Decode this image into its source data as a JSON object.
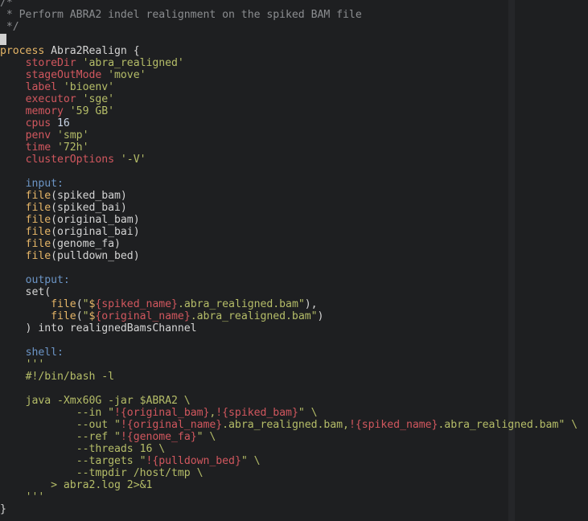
{
  "editor": {
    "theme_colors": {
      "background": "#1e1f21",
      "comment": "#8b8d90",
      "keyword": "#e5b567",
      "property": "#d1575e",
      "string": "#b5bd68",
      "number": "#c9d4e6",
      "label": "#6c95c6",
      "plain": "#d4d4d4"
    },
    "lines": [
      [
        {
          "t": "comment",
          "v": "/*"
        }
      ],
      [
        {
          "t": "comment",
          "v": " * Perform ABRA2 indel realignment on the spiked BAM file"
        }
      ],
      [
        {
          "t": "comment",
          "v": " */"
        }
      ],
      [
        {
          "t": "cursor",
          "v": ""
        }
      ],
      [
        {
          "t": "kw",
          "v": "process"
        },
        {
          "t": "plain",
          "v": " Abra2Realign {"
        }
      ],
      [
        {
          "t": "plain",
          "v": "    "
        },
        {
          "t": "prop",
          "v": "storeDir"
        },
        {
          "t": "plain",
          "v": " "
        },
        {
          "t": "str",
          "v": "'abra_realigned'"
        }
      ],
      [
        {
          "t": "plain",
          "v": "    "
        },
        {
          "t": "prop",
          "v": "stageOutMode"
        },
        {
          "t": "plain",
          "v": " "
        },
        {
          "t": "str",
          "v": "'move'"
        }
      ],
      [
        {
          "t": "plain",
          "v": "    "
        },
        {
          "t": "prop",
          "v": "label"
        },
        {
          "t": "plain",
          "v": " "
        },
        {
          "t": "str",
          "v": "'bioenv'"
        }
      ],
      [
        {
          "t": "plain",
          "v": "    "
        },
        {
          "t": "prop",
          "v": "executor"
        },
        {
          "t": "plain",
          "v": " "
        },
        {
          "t": "str",
          "v": "'sge'"
        }
      ],
      [
        {
          "t": "plain",
          "v": "    "
        },
        {
          "t": "prop",
          "v": "memory"
        },
        {
          "t": "plain",
          "v": " "
        },
        {
          "t": "str",
          "v": "'59 GB'"
        }
      ],
      [
        {
          "t": "plain",
          "v": "    "
        },
        {
          "t": "prop",
          "v": "cpus"
        },
        {
          "t": "plain",
          "v": " "
        },
        {
          "t": "num",
          "v": "16"
        }
      ],
      [
        {
          "t": "plain",
          "v": "    "
        },
        {
          "t": "prop",
          "v": "penv"
        },
        {
          "t": "plain",
          "v": " "
        },
        {
          "t": "str",
          "v": "'smp'"
        }
      ],
      [
        {
          "t": "plain",
          "v": "    "
        },
        {
          "t": "prop",
          "v": "time"
        },
        {
          "t": "plain",
          "v": " "
        },
        {
          "t": "str",
          "v": "'72h'"
        }
      ],
      [
        {
          "t": "plain",
          "v": "    "
        },
        {
          "t": "prop",
          "v": "clusterOptions"
        },
        {
          "t": "plain",
          "v": " "
        },
        {
          "t": "str",
          "v": "'-V'"
        }
      ],
      [
        {
          "t": "plain",
          "v": ""
        }
      ],
      [
        {
          "t": "plain",
          "v": "    "
        },
        {
          "t": "label",
          "v": "input:"
        }
      ],
      [
        {
          "t": "plain",
          "v": "    "
        },
        {
          "t": "kw",
          "v": "file"
        },
        {
          "t": "plain",
          "v": "(spiked_bam)"
        }
      ],
      [
        {
          "t": "plain",
          "v": "    "
        },
        {
          "t": "kw",
          "v": "file"
        },
        {
          "t": "plain",
          "v": "(spiked_bai)"
        }
      ],
      [
        {
          "t": "plain",
          "v": "    "
        },
        {
          "t": "kw",
          "v": "file"
        },
        {
          "t": "plain",
          "v": "(original_bam)"
        }
      ],
      [
        {
          "t": "plain",
          "v": "    "
        },
        {
          "t": "kw",
          "v": "file"
        },
        {
          "t": "plain",
          "v": "(original_bai)"
        }
      ],
      [
        {
          "t": "plain",
          "v": "    "
        },
        {
          "t": "kw",
          "v": "file"
        },
        {
          "t": "plain",
          "v": "(genome_fa)"
        }
      ],
      [
        {
          "t": "plain",
          "v": "    "
        },
        {
          "t": "kw",
          "v": "file"
        },
        {
          "t": "plain",
          "v": "(pulldown_bed)"
        }
      ],
      [
        {
          "t": "plain",
          "v": ""
        }
      ],
      [
        {
          "t": "plain",
          "v": "    "
        },
        {
          "t": "label",
          "v": "output:"
        }
      ],
      [
        {
          "t": "plain",
          "v": "    set("
        }
      ],
      [
        {
          "t": "plain",
          "v": "        "
        },
        {
          "t": "kw",
          "v": "file"
        },
        {
          "t": "plain",
          "v": "("
        },
        {
          "t": "str",
          "v": "\""
        },
        {
          "t": "dollar",
          "v": "$"
        },
        {
          "t": "var",
          "v": "{spiked_name}"
        },
        {
          "t": "str",
          "v": ".abra_realigned.bam\""
        },
        {
          "t": "plain",
          "v": "),"
        }
      ],
      [
        {
          "t": "plain",
          "v": "        "
        },
        {
          "t": "kw",
          "v": "file"
        },
        {
          "t": "plain",
          "v": "("
        },
        {
          "t": "str",
          "v": "\""
        },
        {
          "t": "dollar",
          "v": "$"
        },
        {
          "t": "var",
          "v": "{original_name}"
        },
        {
          "t": "str",
          "v": ".abra_realigned.bam\""
        },
        {
          "t": "plain",
          "v": ")"
        }
      ],
      [
        {
          "t": "plain",
          "v": "    ) into realignedBamsChannel"
        }
      ],
      [
        {
          "t": "plain",
          "v": ""
        }
      ],
      [
        {
          "t": "plain",
          "v": "    "
        },
        {
          "t": "label",
          "v": "shell:"
        }
      ],
      [
        {
          "t": "plain",
          "v": "    "
        },
        {
          "t": "str",
          "v": "'''"
        }
      ],
      [
        {
          "t": "plain",
          "v": "    "
        },
        {
          "t": "str",
          "v": "#!/bin/bash -l"
        }
      ],
      [
        {
          "t": "plain",
          "v": ""
        }
      ],
      [
        {
          "t": "plain",
          "v": "    "
        },
        {
          "t": "str",
          "v": "java -Xmx60G -jar $ABRA2 \\"
        }
      ],
      [
        {
          "t": "plain",
          "v": "            "
        },
        {
          "t": "str",
          "v": "--in \""
        },
        {
          "t": "var",
          "v": "!{original_bam}"
        },
        {
          "t": "str",
          "v": ","
        },
        {
          "t": "var",
          "v": "!{spiked_bam}"
        },
        {
          "t": "str",
          "v": "\" \\"
        }
      ],
      [
        {
          "t": "plain",
          "v": "            "
        },
        {
          "t": "str",
          "v": "--out \""
        },
        {
          "t": "var",
          "v": "!{original_name}"
        },
        {
          "t": "str",
          "v": ".abra_realigned.bam,"
        },
        {
          "t": "var",
          "v": "!{spiked_name}"
        },
        {
          "t": "str",
          "v": ".abra_realigned.bam\" \\"
        }
      ],
      [
        {
          "t": "plain",
          "v": "            "
        },
        {
          "t": "str",
          "v": "--ref \""
        },
        {
          "t": "var",
          "v": "!{genome_fa}"
        },
        {
          "t": "str",
          "v": "\" \\"
        }
      ],
      [
        {
          "t": "plain",
          "v": "            "
        },
        {
          "t": "str",
          "v": "--threads 16 \\"
        }
      ],
      [
        {
          "t": "plain",
          "v": "            "
        },
        {
          "t": "str",
          "v": "--targets \""
        },
        {
          "t": "var",
          "v": "!{pulldown_bed}"
        },
        {
          "t": "str",
          "v": "\" \\"
        }
      ],
      [
        {
          "t": "plain",
          "v": "            "
        },
        {
          "t": "str",
          "v": "--tmpdir /host/tmp \\"
        }
      ],
      [
        {
          "t": "plain",
          "v": "        "
        },
        {
          "t": "str",
          "v": "> abra2.log 2>&1"
        }
      ],
      [
        {
          "t": "plain",
          "v": "    "
        },
        {
          "t": "str",
          "v": "'''"
        }
      ],
      [
        {
          "t": "plain",
          "v": "}"
        }
      ]
    ]
  }
}
